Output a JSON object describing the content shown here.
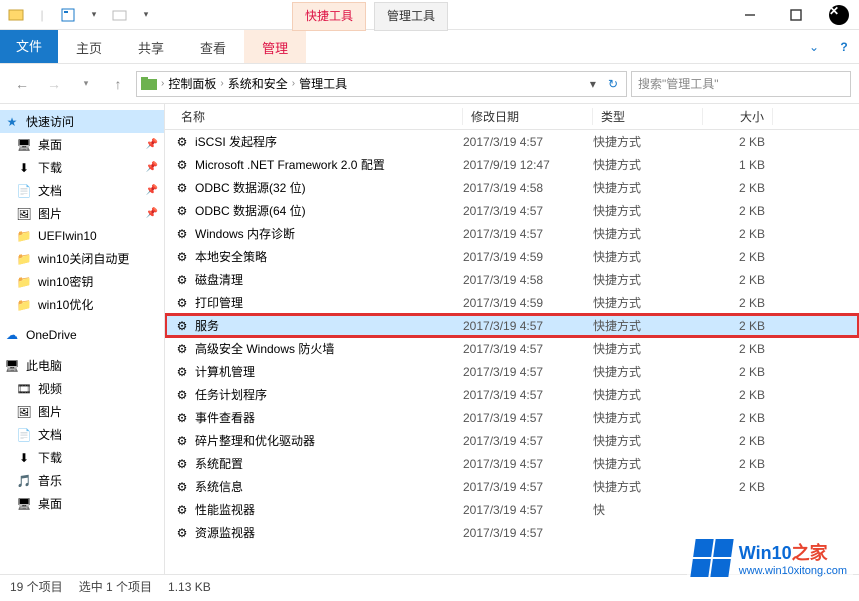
{
  "titlebar": {
    "context_tabs": [
      "快捷工具",
      "管理工具"
    ]
  },
  "ribbon": {
    "file": "文件",
    "tabs": [
      "主页",
      "共享",
      "查看",
      "管理"
    ]
  },
  "address": {
    "breadcrumbs": [
      "控制面板",
      "系统和安全",
      "管理工具"
    ],
    "search_placeholder": "搜索\"管理工具\""
  },
  "sidebar": {
    "quick_access": {
      "label": "快速访问",
      "starred": true
    },
    "quick_items": [
      {
        "label": "桌面",
        "pinned": true,
        "icon": "🖥"
      },
      {
        "label": "下载",
        "pinned": true,
        "icon": "⬇"
      },
      {
        "label": "文档",
        "pinned": true,
        "icon": "📄"
      },
      {
        "label": "图片",
        "pinned": true,
        "icon": "🖼"
      },
      {
        "label": "UEFIwin10",
        "pinned": false,
        "icon": "📁"
      },
      {
        "label": "win10关闭自动更",
        "pinned": false,
        "icon": "📁"
      },
      {
        "label": "win10密钥",
        "pinned": false,
        "icon": "📁"
      },
      {
        "label": "win10优化",
        "pinned": false,
        "icon": "📁"
      }
    ],
    "onedrive": {
      "label": "OneDrive"
    },
    "thispc": {
      "label": "此电脑"
    },
    "pc_items": [
      {
        "label": "视频",
        "icon": "🎞"
      },
      {
        "label": "图片",
        "icon": "🖼"
      },
      {
        "label": "文档",
        "icon": "📄"
      },
      {
        "label": "下载",
        "icon": "⬇"
      },
      {
        "label": "音乐",
        "icon": "🎵"
      },
      {
        "label": "桌面",
        "icon": "🖥"
      }
    ]
  },
  "columns": {
    "name": "名称",
    "date": "修改日期",
    "type": "类型",
    "size": "大小"
  },
  "files": [
    {
      "name": "iSCSI 发起程序",
      "date": "2017/3/19 4:57",
      "type": "快捷方式",
      "size": "2 KB"
    },
    {
      "name": "Microsoft .NET Framework 2.0 配置",
      "date": "2017/9/19 12:47",
      "type": "快捷方式",
      "size": "1 KB"
    },
    {
      "name": "ODBC 数据源(32 位)",
      "date": "2017/3/19 4:58",
      "type": "快捷方式",
      "size": "2 KB"
    },
    {
      "name": "ODBC 数据源(64 位)",
      "date": "2017/3/19 4:57",
      "type": "快捷方式",
      "size": "2 KB"
    },
    {
      "name": "Windows 内存诊断",
      "date": "2017/3/19 4:57",
      "type": "快捷方式",
      "size": "2 KB"
    },
    {
      "name": "本地安全策略",
      "date": "2017/3/19 4:59",
      "type": "快捷方式",
      "size": "2 KB"
    },
    {
      "name": "磁盘清理",
      "date": "2017/3/19 4:58",
      "type": "快捷方式",
      "size": "2 KB"
    },
    {
      "name": "打印管理",
      "date": "2017/3/19 4:59",
      "type": "快捷方式",
      "size": "2 KB"
    },
    {
      "name": "服务",
      "date": "2017/3/19 4:57",
      "type": "快捷方式",
      "size": "2 KB",
      "selected": true,
      "highlighted": true
    },
    {
      "name": "高级安全 Windows 防火墙",
      "date": "2017/3/19 4:57",
      "type": "快捷方式",
      "size": "2 KB"
    },
    {
      "name": "计算机管理",
      "date": "2017/3/19 4:57",
      "type": "快捷方式",
      "size": "2 KB"
    },
    {
      "name": "任务计划程序",
      "date": "2017/3/19 4:57",
      "type": "快捷方式",
      "size": "2 KB"
    },
    {
      "name": "事件查看器",
      "date": "2017/3/19 4:57",
      "type": "快捷方式",
      "size": "2 KB"
    },
    {
      "name": "碎片整理和优化驱动器",
      "date": "2017/3/19 4:57",
      "type": "快捷方式",
      "size": "2 KB"
    },
    {
      "name": "系统配置",
      "date": "2017/3/19 4:57",
      "type": "快捷方式",
      "size": "2 KB"
    },
    {
      "name": "系统信息",
      "date": "2017/3/19 4:57",
      "type": "快捷方式",
      "size": "2 KB"
    },
    {
      "name": "性能监视器",
      "date": "2017/3/19 4:57",
      "type": "快",
      "size": ""
    },
    {
      "name": "资源监视器",
      "date": "2017/3/19 4:57",
      "type": "",
      "size": ""
    }
  ],
  "status": {
    "count": "19 个项目",
    "selected": "选中 1 个项目",
    "size": "1.13 KB"
  },
  "watermark": {
    "title_a": "Win10",
    "title_b": "之家",
    "url": "www.win10xitong.com"
  }
}
